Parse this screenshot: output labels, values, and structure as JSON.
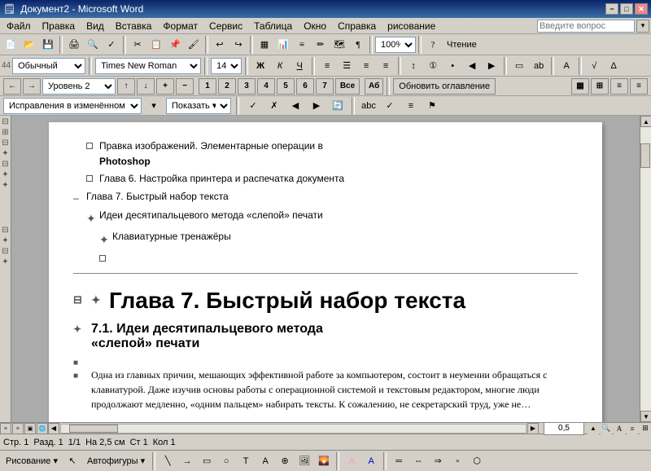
{
  "titlebar": {
    "title": "Документ2 - Microsoft Word",
    "min_btn": "−",
    "max_btn": "□",
    "close_btn": "✕"
  },
  "menubar": {
    "items": [
      "Файл",
      "Правка",
      "Вид",
      "Вставка",
      "Формат",
      "Сервис",
      "Таблица",
      "Окно",
      "Справка",
      "рисование"
    ],
    "search_placeholder": "Введите вопрос"
  },
  "format_toolbar": {
    "style": "Обычный",
    "size_prefix": "44",
    "font": "Times New Roman",
    "font_size": "14",
    "bold": "Ж",
    "italic": "К",
    "underline": "Ч",
    "zoom": "100%",
    "read_btn": "Чтение"
  },
  "outline_toolbar": {
    "level": "Уровень 2",
    "update_toc": "Обновить оглавление"
  },
  "track_toolbar": {
    "track_select": "Исправления в изменённом документе",
    "show_label": "Показать ▾"
  },
  "document": {
    "toc_items": [
      {
        "indent": 1,
        "bullet": "■",
        "text": "Правка изображений. Элементарные операции в Photoshop"
      },
      {
        "indent": 1,
        "bullet": "■",
        "text": "Глава 6. Настройка принтера и распечатка документа"
      },
      {
        "indent": 0,
        "bullet": "–",
        "text": "Глава 7. Быстрый набор текста"
      },
      {
        "indent": 1,
        "bullet": "✦",
        "text": "Идеи десятипальцевого метода «слепой» печати"
      },
      {
        "indent": 2,
        "bullet": "✦",
        "text": "Клавиатурные тренажёры"
      },
      {
        "indent": 2,
        "bullet": "■",
        "text": ""
      }
    ],
    "chapter_heading": "Глава 7. Быстрый набор текста",
    "sub_heading": "7.1. Идеи десятипальцевого метода «слепой» печати",
    "body_paragraph": "Одна из главных причин, мешающих эффективной работе за компьютером, состоит в неумении обращаться с клавиатурой. Даже изучив основы работы с операционной системой и текстовым редактором, многие люди продолжают медленно, «одним пальцем» набирать тексты. К сожалению, не секретарский труд, уже не…"
  },
  "bottom": {
    "page_indicator": "",
    "scroll_value": "0,5",
    "drawing_label": "Рисование ▾",
    "autoshapes_label": "Автофигуры ▾"
  }
}
